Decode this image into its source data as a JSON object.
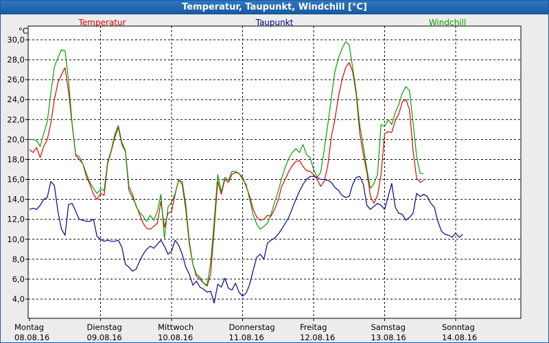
{
  "window": {
    "title": "Temperatur, Taupunkt, Windchill [°C]"
  },
  "chart_data": {
    "type": "line",
    "title": "Temperatur, Taupunkt, Windchill [°C]",
    "ylabel": "°C",
    "ylim": [
      4,
      30
    ],
    "xlim": [
      0,
      7
    ],
    "grid": true,
    "yticks": [
      4,
      6,
      8,
      10,
      12,
      14,
      16,
      18,
      20,
      22,
      24,
      26,
      28,
      30
    ],
    "ytick_labels": [
      "4,0",
      "6,0",
      "8,0",
      "10,0",
      "12,0",
      "14,0",
      "16,0",
      "18,0",
      "20,0",
      "22,0",
      "24,0",
      "26,0",
      "28,0",
      "30,0"
    ],
    "x_ticks": [
      {
        "x": 0,
        "day": "Montag",
        "date": "08.08.16"
      },
      {
        "x": 1,
        "day": "Dienstag",
        "date": "09.08.16"
      },
      {
        "x": 2,
        "day": "Mittwoch",
        "date": "10.08.16"
      },
      {
        "x": 3,
        "day": "Donnerstag",
        "date": "11.08.16"
      },
      {
        "x": 4,
        "day": "Freitag",
        "date": "12.08.16"
      },
      {
        "x": 5,
        "day": "Samstag",
        "date": "13.08.16"
      },
      {
        "x": 6,
        "day": "Sonntag",
        "date": "14.08.16"
      }
    ],
    "legend_position": "top",
    "x": [
      0.0,
      0.05,
      0.1,
      0.15,
      0.2,
      0.25,
      0.3,
      0.35,
      0.4,
      0.45,
      0.5,
      0.55,
      0.6,
      0.65,
      0.7,
      0.75,
      0.8,
      0.85,
      0.9,
      0.95,
      1.0,
      1.05,
      1.1,
      1.15,
      1.2,
      1.25,
      1.3,
      1.35,
      1.4,
      1.45,
      1.5,
      1.55,
      1.6,
      1.65,
      1.7,
      1.75,
      1.8,
      1.85,
      1.9,
      1.95,
      2.0,
      2.05,
      2.1,
      2.15,
      2.2,
      2.25,
      2.3,
      2.35,
      2.4,
      2.45,
      2.5,
      2.55,
      2.6,
      2.65,
      2.7,
      2.75,
      2.8,
      2.85,
      2.9,
      2.95,
      3.0,
      3.05,
      3.1,
      3.15,
      3.2,
      3.25,
      3.3,
      3.35,
      3.4,
      3.45,
      3.5,
      3.55,
      3.6,
      3.65,
      3.7,
      3.75,
      3.8,
      3.85,
      3.9,
      3.95,
      4.0,
      4.05,
      4.1,
      4.15,
      4.2,
      4.25,
      4.3,
      4.35,
      4.4,
      4.45,
      4.5,
      4.55,
      4.6,
      4.65,
      4.7,
      4.75,
      4.8,
      4.85,
      4.9,
      4.95,
      5.0,
      5.05,
      5.1,
      5.15,
      5.2,
      5.25,
      5.3,
      5.35,
      5.4,
      5.45,
      5.5,
      5.55,
      5.6,
      5.65,
      5.7,
      5.75,
      5.8,
      5.85,
      5.9,
      5.95,
      6.0,
      6.05,
      6.1,
      6.15,
      6.2,
      6.25,
      6.3,
      6.35,
      6.4,
      6.45,
      6.5,
      6.55,
      6.6,
      6.65,
      6.7,
      6.75,
      6.8,
      6.85,
      6.9,
      6.95
    ],
    "series": [
      {
        "name": "Temperatur",
        "color": "#e00000",
        "values": [
          19.0,
          18.7,
          19.2,
          18.2,
          19.3,
          20.0,
          21.6,
          24.0,
          25.7,
          26.5,
          27.2,
          24.8,
          21.5,
          18.4,
          18.0,
          17.6,
          16.3,
          15.5,
          14.5,
          14.0,
          14.6,
          14.4,
          17.6,
          18.8,
          20.2,
          21.2,
          19.5,
          18.8,
          14.9,
          14.2,
          13.4,
          12.5,
          11.6,
          11.1,
          11.0,
          11.3,
          11.6,
          13.8,
          11.2,
          12.6,
          12.8,
          14.5,
          16.0,
          15.5,
          13.0,
          9.5,
          7.5,
          6.3,
          6.0,
          5.6,
          5.3,
          6.5,
          11.0,
          15.8,
          14.5,
          16.0,
          15.7,
          16.5,
          16.7,
          16.6,
          16.2,
          15.3,
          14.3,
          13.0,
          12.2,
          11.9,
          12.0,
          12.4,
          12.3,
          13.0,
          13.9,
          15.3,
          16.0,
          16.8,
          17.4,
          17.8,
          17.9,
          17.3,
          16.9,
          16.8,
          16.5,
          16.0,
          15.3,
          15.8,
          17.4,
          20.3,
          22.0,
          24.3,
          26.0,
          27.2,
          27.7,
          26.8,
          24.5,
          20.6,
          18.5,
          16.7,
          14.3,
          13.6,
          14.4,
          16.5,
          20.6,
          20.8,
          20.7,
          21.9,
          22.6,
          23.8,
          24.0,
          23.0,
          18.9,
          16.1,
          15.7,
          15.9
        ],
        "x_count_note": ""
      },
      {
        "name": "Taupunkt",
        "color": "#00008b",
        "values": [
          13.0,
          13.1,
          13.0,
          13.4,
          14.0,
          14.2,
          15.8,
          15.4,
          12.8,
          11.0,
          10.4,
          13.5,
          13.6,
          12.8,
          12.0,
          11.9,
          11.8,
          11.8,
          12.0,
          10.3,
          10.0,
          9.8,
          9.9,
          9.8,
          9.8,
          9.9,
          9.2,
          7.5,
          7.2,
          6.8,
          7.0,
          7.8,
          8.5,
          9.0,
          9.3,
          9.1,
          9.5,
          9.9,
          9.3,
          8.5,
          8.8,
          9.9,
          9.4,
          8.5,
          7.2,
          6.5,
          5.4,
          5.8,
          5.2,
          5.0,
          4.7,
          4.8,
          3.6,
          5.5,
          5.2,
          6.1,
          5.1,
          4.9,
          5.6,
          4.7,
          4.3,
          4.6,
          5.5,
          6.9,
          8.2,
          8.5,
          8.0,
          9.6,
          9.9,
          10.1,
          10.5,
          11.0,
          11.6,
          12.2,
          13.1,
          14.0,
          14.8,
          15.5,
          16.0,
          16.3,
          16.3,
          16.2,
          16.0,
          16.0,
          15.9,
          15.7,
          15.2,
          14.9,
          14.4,
          14.2,
          14.3,
          15.5,
          16.2,
          16.3,
          15.5,
          13.4,
          13.0,
          13.3,
          13.6,
          13.4,
          13.0,
          14.3,
          15.6,
          13.2,
          12.6,
          12.5,
          11.9,
          12.2,
          12.6,
          14.6,
          14.3,
          14.5,
          14.3,
          13.6,
          13.2,
          11.8,
          10.8,
          10.5,
          10.4,
          10.2,
          10.6,
          10.2,
          10.5
        ]
      },
      {
        "name": "Windchill",
        "color": "#00a000",
        "values": [
          20.0,
          20.0,
          19.9,
          19.3,
          20.6,
          21.8,
          24.6,
          27.3,
          28.2,
          29.0,
          28.9,
          25.9,
          21.6,
          18.5,
          18.3,
          17.6,
          16.6,
          15.7,
          15.1,
          14.6,
          15.0,
          14.9,
          17.8,
          18.9,
          20.5,
          21.4,
          19.7,
          18.9,
          15.3,
          14.5,
          13.3,
          12.7,
          12.3,
          11.8,
          12.4,
          11.9,
          12.8,
          14.5,
          10.1,
          13.2,
          13.7,
          14.6,
          15.9,
          15.8,
          13.5,
          9.8,
          7.5,
          6.5,
          6.2,
          5.6,
          5.4,
          7.6,
          11.8,
          16.5,
          14.7,
          16.2,
          15.9,
          16.8,
          16.8,
          16.6,
          16.0,
          15.5,
          14.0,
          12.4,
          11.5,
          11.0,
          11.3,
          11.6,
          12.5,
          13.7,
          14.8,
          16.1,
          17.2,
          18.1,
          18.7,
          19.1,
          18.7,
          19.5,
          18.5,
          18.2,
          17.0,
          16.2,
          16.7,
          19.0,
          21.5,
          24.2,
          26.8,
          28.2,
          29.1,
          29.8,
          29.5,
          27.2,
          24.8,
          21.4,
          19.3,
          17.0,
          15.1,
          15.6,
          16.5,
          21.5,
          21.3,
          22.0,
          21.5,
          22.7,
          23.5,
          24.7,
          25.3,
          24.9,
          21.7,
          18.3,
          16.6,
          16.6
        ]
      }
    ]
  }
}
